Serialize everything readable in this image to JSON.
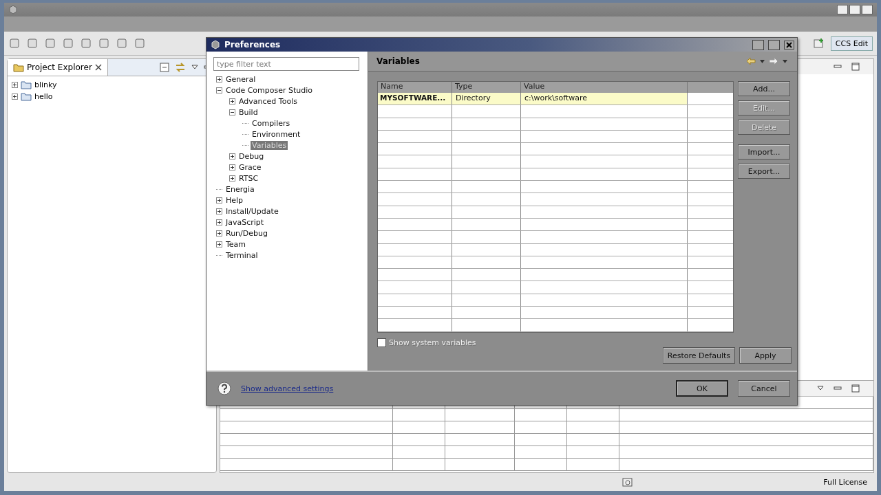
{
  "explorer": {
    "title": "Project Explorer",
    "items": [
      {
        "label": "blinky",
        "expanded": false
      },
      {
        "label": "hello",
        "expanded": false
      }
    ]
  },
  "perspective": {
    "label": "CCS Edit",
    "selected": true
  },
  "dialog": {
    "title": "Preferences",
    "filter": {
      "placeholder": "type filter text"
    },
    "tree": [
      {
        "label": "General",
        "expanded": false,
        "selected": false
      },
      {
        "label": "Code Composer Studio",
        "expanded": true,
        "selected": false,
        "children": [
          {
            "label": "Advanced Tools",
            "expanded": false,
            "selected": false
          },
          {
            "label": "Build",
            "expanded": true,
            "selected": false,
            "children": [
              {
                "label": "Compilers",
                "selected": false
              },
              {
                "label": "Environment",
                "selected": false
              },
              {
                "label": "Variables",
                "selected": true
              }
            ]
          },
          {
            "label": "Debug",
            "expanded": false,
            "selected": false
          },
          {
            "label": "Grace",
            "expanded": false,
            "selected": false
          },
          {
            "label": "RTSC",
            "expanded": false,
            "selected": false
          }
        ]
      },
      {
        "label": "Energia",
        "selected": false
      },
      {
        "label": "Help",
        "expanded": false,
        "selected": false
      },
      {
        "label": "Install/Update",
        "expanded": false,
        "selected": false
      },
      {
        "label": "JavaScript",
        "expanded": false,
        "selected": false
      },
      {
        "label": "Run/Debug",
        "expanded": false,
        "selected": false
      },
      {
        "label": "Team",
        "expanded": false,
        "selected": false
      },
      {
        "label": "Terminal",
        "selected": false
      }
    ],
    "page": {
      "title": "Variables",
      "table": {
        "columns": [
          "Name",
          "Type",
          "Value"
        ],
        "rows": [
          {
            "name": "MYSOFTWARE...",
            "type": "Directory",
            "value": "c:\\work\\software",
            "selected": true
          }
        ]
      },
      "side_buttons": [
        {
          "label": "Add...",
          "disabled": false
        },
        {
          "label": "Edit...",
          "disabled": true
        },
        {
          "label": "Delete",
          "disabled": true
        },
        {
          "label": "Import...",
          "disabled": false
        },
        {
          "label": "Export...",
          "disabled": false
        }
      ],
      "show_system_variables": {
        "label": "Show system variables",
        "checked": false
      },
      "buttons": [
        {
          "label": "Restore Defaults",
          "disabled": false
        },
        {
          "label": "Apply",
          "disabled": false
        }
      ]
    },
    "help_link": "Show advanced settings",
    "buttons": [
      {
        "label": "OK",
        "default": true
      },
      {
        "label": "Cancel",
        "default": false
      }
    ]
  },
  "status_bar": {
    "license": "Full License"
  }
}
